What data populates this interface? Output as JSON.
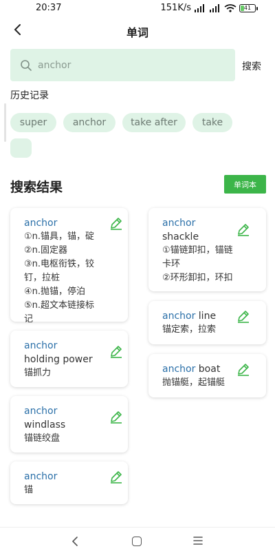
{
  "status_bar": {
    "time": "20:37",
    "net_speed": "151K/s",
    "battery_level": "41"
  },
  "nav": {
    "title": "单词"
  },
  "search": {
    "value": "anchor",
    "button_label": "搜索"
  },
  "history": {
    "title": "历史记录",
    "chips": [
      "super",
      "anchor",
      "take after",
      "take",
      ""
    ]
  },
  "results": {
    "title": "搜索结果",
    "wordbook_label": "单词本"
  },
  "cards": [
    {
      "keyword": "anchor",
      "rest": "",
      "defs": [
        "①n.锚具，锚，碇",
        "②n.固定器",
        "③n.电枢衔铁，铰钉，拉桩",
        "④n.抛锚，停泊",
        "⑤n.超文本链接标记"
      ]
    },
    {
      "keyword": "anchor",
      "rest": " holding power",
      "defs": [
        "锚抓力"
      ]
    },
    {
      "keyword": "anchor",
      "rest": " windlass",
      "defs": [
        "锚链绞盘"
      ]
    },
    {
      "keyword": "anchor",
      "rest": "",
      "defs": [
        "锚"
      ]
    },
    {
      "keyword": "anchor",
      "rest": " shackle",
      "defs": [
        "①锚链卸扣，锚链卡环",
        "②环形卸扣，环扣"
      ]
    },
    {
      "keyword": "anchor",
      "rest": " line",
      "defs": [
        "锚定索，拉索"
      ]
    },
    {
      "keyword": "anchor",
      "rest": " boat",
      "defs": [
        "抛锚艇，起锚艇"
      ]
    }
  ],
  "colors": {
    "accent_green": "#3cb549",
    "search_bg": "#dff3e6",
    "keyword_blue": "#2a6fa8"
  }
}
